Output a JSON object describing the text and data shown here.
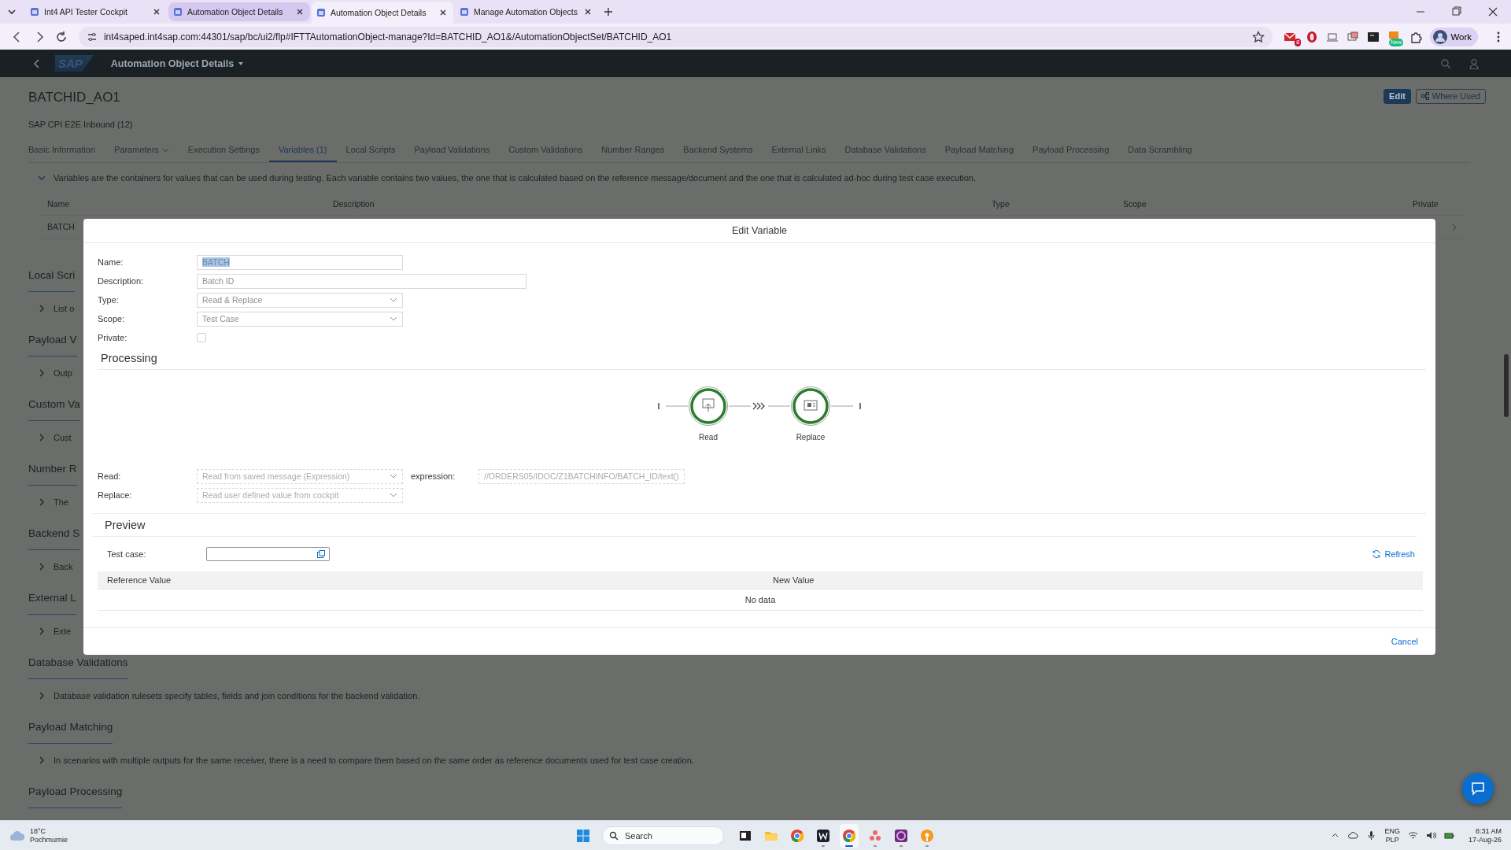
{
  "browser": {
    "tabs": [
      {
        "title": "Int4 API Tester Cockpit",
        "selected": false,
        "hovered": false
      },
      {
        "title": "Automation Object Details",
        "selected": false,
        "hovered": true
      },
      {
        "title": "Automation Object Details",
        "selected": true,
        "hovered": false
      },
      {
        "title": "Manage Automation Objects",
        "selected": false,
        "hovered": false
      }
    ],
    "url": "int4saped.int4sap.com:44301/sap/bc/ui2/flp#IFTTAutomationObject-manage?Id=BATCHID_AO1&/AutomationObjectSet/BATCHID_AO1",
    "mail_badge": "8",
    "new_badge": "New",
    "profile": "Work"
  },
  "shell": {
    "logo": "SAP",
    "title": "Automation Object Details"
  },
  "page": {
    "title": "BATCHID_AO1",
    "subtitle": "SAP CPI E2E Inbound (12)",
    "actions": [
      {
        "label": "Edit",
        "kind": "emphasized"
      },
      {
        "label": "Where Used",
        "kind": "transparent"
      }
    ],
    "tabs": [
      {
        "label": "Basic Information",
        "selected": false,
        "has_menu": false
      },
      {
        "label": "Parameters",
        "selected": false,
        "has_menu": true
      },
      {
        "label": "Execution Settings",
        "selected": false,
        "has_menu": false
      },
      {
        "label": "Variables (1)",
        "selected": true,
        "has_menu": false
      },
      {
        "label": "Local Scripts",
        "selected": false,
        "has_menu": false
      },
      {
        "label": "Payload Validations",
        "selected": false,
        "has_menu": false
      },
      {
        "label": "Custom Validations",
        "selected": false,
        "has_menu": false
      },
      {
        "label": "Number Ranges",
        "selected": false,
        "has_menu": false
      },
      {
        "label": "Backend Systems",
        "selected": false,
        "has_menu": false
      },
      {
        "label": "External Links",
        "selected": false,
        "has_menu": false
      },
      {
        "label": "Database Validations",
        "selected": false,
        "has_menu": false
      },
      {
        "label": "Payload Matching",
        "selected": false,
        "has_menu": false
      },
      {
        "label": "Payload Processing",
        "selected": false,
        "has_menu": false
      },
      {
        "label": "Data Scrambling",
        "selected": false,
        "has_menu": false
      }
    ],
    "variables": {
      "info": "Variables are the containers for values that can be used during testing. Each variable contains two values, the one that is calculated based on the reference message/document and the one that is calculated ad-hoc during test case execution.",
      "columns": [
        "Name",
        "Description",
        "Type",
        "Scope",
        "Private"
      ],
      "row_name": "BATCH"
    },
    "sections": [
      {
        "title": "Local Scri",
        "text": "List o"
      },
      {
        "title": "Payload V",
        "text": "Outp"
      },
      {
        "title": "Custom Va",
        "text": "Cust"
      },
      {
        "title": "Number R",
        "text": "The"
      },
      {
        "title": "Backend S",
        "text": "Back"
      },
      {
        "title": "External L",
        "text": "Exte"
      },
      {
        "title": "Database Validations",
        "text": "Database validation rulesets specify tables, fields and join conditions for the backend validation."
      },
      {
        "title": "Payload Matching",
        "text": "In scenarios with multiple outputs for the same receiver, there is a need to compare them based on the same order as reference documents used for test case creation."
      },
      {
        "title": "Payload Processing"
      }
    ]
  },
  "dialog": {
    "title": "Edit Variable",
    "fields": [
      {
        "label": "Name:",
        "kind": "text",
        "value": "BATCH",
        "text_selected": true
      },
      {
        "label": "Description:",
        "kind": "wide",
        "value": "Batch ID"
      },
      {
        "label": "Type:",
        "kind": "select",
        "value": "Read & Replace"
      },
      {
        "label": "Scope:",
        "kind": "select",
        "value": "Test Case"
      },
      {
        "label": "Private:",
        "kind": "checkbox",
        "checked": false
      }
    ],
    "processing": {
      "title": "Processing",
      "steps": [
        {
          "label": "Read",
          "kind": "read"
        },
        {
          "label": "Replace",
          "kind": "replace"
        }
      ],
      "read_label": "Read:",
      "read_value": "Read from saved message (Expression)",
      "expression_label": "expression:",
      "expression_value": "//ORDERS05/IDOC/Z1BATCHINFO/BATCH_ID/text()",
      "replace_label": "Replace:",
      "replace_value": "Read user defined value from cockpit"
    },
    "preview": {
      "title": "Preview",
      "test_case_label": "Test case:",
      "refresh": "Refresh",
      "columns": [
        "Reference Value",
        "New Value"
      ],
      "empty": "No data"
    },
    "cancel": "Cancel"
  },
  "taskbar": {
    "temperature": "18°C",
    "condition": "Pochmurnie",
    "search_placeholder": "Search",
    "apps": [
      {
        "kind": "terminal",
        "running": false,
        "selected": false
      },
      {
        "kind": "folder",
        "running": false,
        "selected": false
      },
      {
        "kind": "chrome",
        "running": false,
        "selected": false
      },
      {
        "kind": "editor",
        "running": true,
        "selected": false
      },
      {
        "kind": "chrome",
        "running": true,
        "selected": true
      },
      {
        "kind": "dots",
        "running": true,
        "selected": false
      },
      {
        "kind": "disc",
        "running": true,
        "selected": false
      },
      {
        "kind": "podcast",
        "running": true,
        "selected": false
      }
    ],
    "language": "ENG",
    "layout": "PLP",
    "time": "8:31 AM",
    "date": "17-Aug-26"
  }
}
